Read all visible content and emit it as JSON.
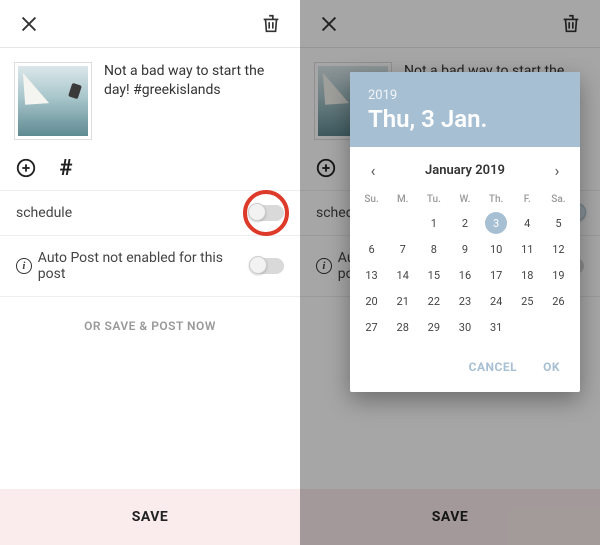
{
  "left": {
    "caption": "Not a bad way to start the day! #greekislands",
    "schedule_label": "schedule",
    "autopost_label": "Auto Post not enabled for this post",
    "or_save_label": "OR SAVE & POST NOW",
    "save_label": "SAVE"
  },
  "right": {
    "caption": "Not a bad way to start the day! #greekislands",
    "save_label": "SAVE"
  },
  "picker": {
    "year": "2019",
    "date_display": "Thu, 3 Jan.",
    "month_title": "January 2019",
    "dow": [
      "Su.",
      "M.",
      "Tu.",
      "W.",
      "Th.",
      "F.",
      "Sa."
    ],
    "grid": [
      [
        "",
        "",
        "1",
        "2",
        "3",
        "4",
        "5"
      ],
      [
        "6",
        "7",
        "8",
        "9",
        "10",
        "11",
        "12"
      ],
      [
        "13",
        "14",
        "15",
        "16",
        "17",
        "18",
        "19"
      ],
      [
        "20",
        "21",
        "22",
        "23",
        "24",
        "25",
        "26"
      ],
      [
        "27",
        "28",
        "29",
        "30",
        "31",
        "",
        ""
      ]
    ],
    "selected": "3",
    "cancel": "CANCEL",
    "ok": "OK"
  }
}
